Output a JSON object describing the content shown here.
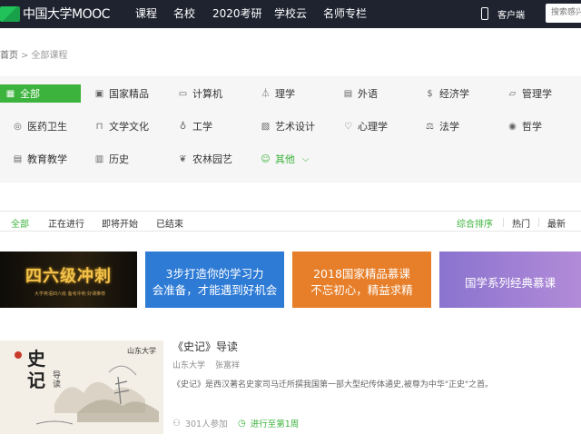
{
  "header": {
    "logo_text": "中国大学MOOC",
    "nav": [
      "课程",
      "名校",
      "2020考研",
      "学校云",
      "名师专栏"
    ],
    "client_label": "客户端",
    "search_placeholder": "搜索感兴趣的课程"
  },
  "breadcrumb": {
    "home": "首页",
    "sep": ">",
    "current": "全部课程"
  },
  "categories": [
    {
      "label": "全部",
      "icon": "grid-icon"
    },
    {
      "label": "国家精品",
      "icon": "national-quality-icon"
    },
    {
      "label": "计算机",
      "icon": "computer-icon"
    },
    {
      "label": "理学",
      "icon": "flask-icon"
    },
    {
      "label": "外语",
      "icon": "chat-icon"
    },
    {
      "label": "经济学",
      "icon": "coin-icon"
    },
    {
      "label": "管理学",
      "icon": "briefcase-icon"
    },
    {
      "label": "医药卫生",
      "icon": "pill-icon"
    },
    {
      "label": "文学文化",
      "icon": "book-icon"
    },
    {
      "label": "工学",
      "icon": "bulb-icon"
    },
    {
      "label": "艺术设计",
      "icon": "image-icon"
    },
    {
      "label": "心理学",
      "icon": "heart-icon"
    },
    {
      "label": "法学",
      "icon": "scales-icon"
    },
    {
      "label": "哲学",
      "icon": "location-icon"
    },
    {
      "label": "教育教学",
      "icon": "document-icon"
    },
    {
      "label": "历史",
      "icon": "notebook-icon"
    },
    {
      "label": "农林园艺",
      "icon": "leaf-icon"
    },
    {
      "label": "其他",
      "icon": "smile-icon"
    }
  ],
  "status_tabs": [
    "全部",
    "正在进行",
    "即将开始",
    "已结束"
  ],
  "sort_tabs": [
    "综合排序",
    "热门",
    "最新"
  ],
  "banners": [
    {
      "title": "四六级冲刺",
      "subtitle": "大学英语四六级 备考冲刺 好课推荐"
    },
    {
      "line1": "3步打造你的学习力",
      "line2": "会准备，才能遇到好机会"
    },
    {
      "line1": "2018国家精品慕课",
      "line2": "不忘初心，精益求精"
    },
    {
      "line1": "国学系列经典慕课"
    }
  ],
  "course": {
    "title": "《史记》导读",
    "school": "山东大学",
    "teacher": "张富祥",
    "description": "《史记》是西汉著名史家司马迁所撰我国第一部大型纪传体通史,被尊为中华\"正史\"之首。",
    "enrolled": "301人参加",
    "progress": "进行至第1周",
    "image_calligraphy": "史记",
    "image_subtext": "导读",
    "school_logo_text": "山东大学"
  },
  "colors": {
    "accent": "#3cb33c",
    "topbar": "#1f2330",
    "panel": "#f6f6f6"
  }
}
